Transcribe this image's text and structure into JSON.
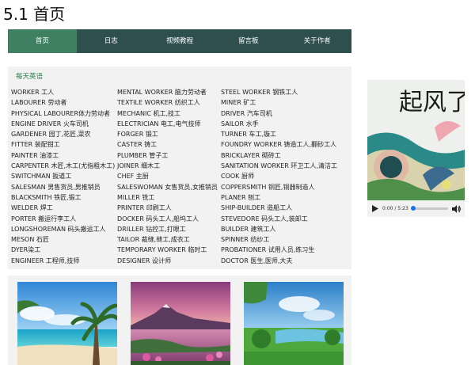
{
  "page": {
    "title": "5.1 首页"
  },
  "nav": {
    "items": [
      {
        "label": "首页",
        "active": true
      },
      {
        "label": "日志",
        "active": false
      },
      {
        "label": "视频教程",
        "active": false
      },
      {
        "label": "留言板",
        "active": false
      },
      {
        "label": "关于作者",
        "active": false
      }
    ]
  },
  "english": {
    "title": "每天英语",
    "columns": [
      [
        "WORKER 工人",
        "LABOURER 劳动者",
        "PHYSICAL LABOURER体力劳动者",
        "ENGINE DRIVER 火车司机",
        "GARDENER 园丁,花匠,菜农",
        "FITTER 装配钳工",
        "PAINTER 油漆工",
        "CARPENTER 木匠,木工(尤指粗木工)",
        "SWITCHMAN 扳道工",
        "SALESMAN 男售货员,男推销员",
        "BLACKSMITH 铁匠,锻工",
        "WELDER 焊工",
        "PORTER 搬运行李工人",
        "LONGSHOREMAN 码头搬运工人",
        "MESON 石匠",
        "DYER染工",
        "ENGINEER 工程师,技师"
      ],
      [
        "MENTAL WORKER 脑力劳动者",
        "TEXTILE WORKER 纺织工人",
        "MECHANIC 机工,技工",
        "ELECTRICIAN 电工,电气技师",
        "FORGER 锻工",
        "CASTER 铸工",
        "PLUMBER 管子工",
        "JOINER 细木工",
        "CHEF 主厨",
        "SALESWOMAN 女售货员,女推销员",
        "MILLER 铣工",
        "PRINTER 印刷工人",
        "DOCKER 码头工人,船坞工人",
        "DRILLER 钻控工,打眼工",
        "TAILOR 裁缝,缝工,成衣工",
        "TEMPORARY WORKER 临时工",
        "DESIGNER 设计师"
      ],
      [
        " STEEL WORKER 钢铁工人",
        "MINER 矿工",
        "DRIVER 汽车司机",
        "SAILOR 水手",
        "TURNER 车工,镟工",
        "FOUNDRY WORKER 铸造工人,翻砂工人",
        "BRICKLAYER 砌砖工",
        "SANITATION WORKER 环卫工人,清洁工",
        "COOK 厨师",
        "COPPERSMITH 铜匠,铜器制造人",
        "PLANER 刨工",
        "SHIP-BUILDER 造船工人",
        "STEVEDORE 码头工人,装卸工",
        "BUILDER 建筑工人",
        "SPINNER 纺纱工",
        "PROBATIONER 试用人员,练习生",
        "DOCTOR 医生,医师,大夫"
      ]
    ]
  },
  "media": {
    "video_art_text": "起风了",
    "current_time": "0:00",
    "duration": "5:23",
    "time_display": "0:00 / 5:23",
    "progress": 0.0
  },
  "photos": [
    {
      "name": "beach-photo"
    },
    {
      "name": "mountain-lake-photo"
    },
    {
      "name": "green-park-photo"
    }
  ],
  "colors": {
    "nav_bg": "#2f4f4f",
    "nav_active": "#3f8060",
    "accent": "#1a73e8",
    "section_title": "#2e7d4f"
  }
}
